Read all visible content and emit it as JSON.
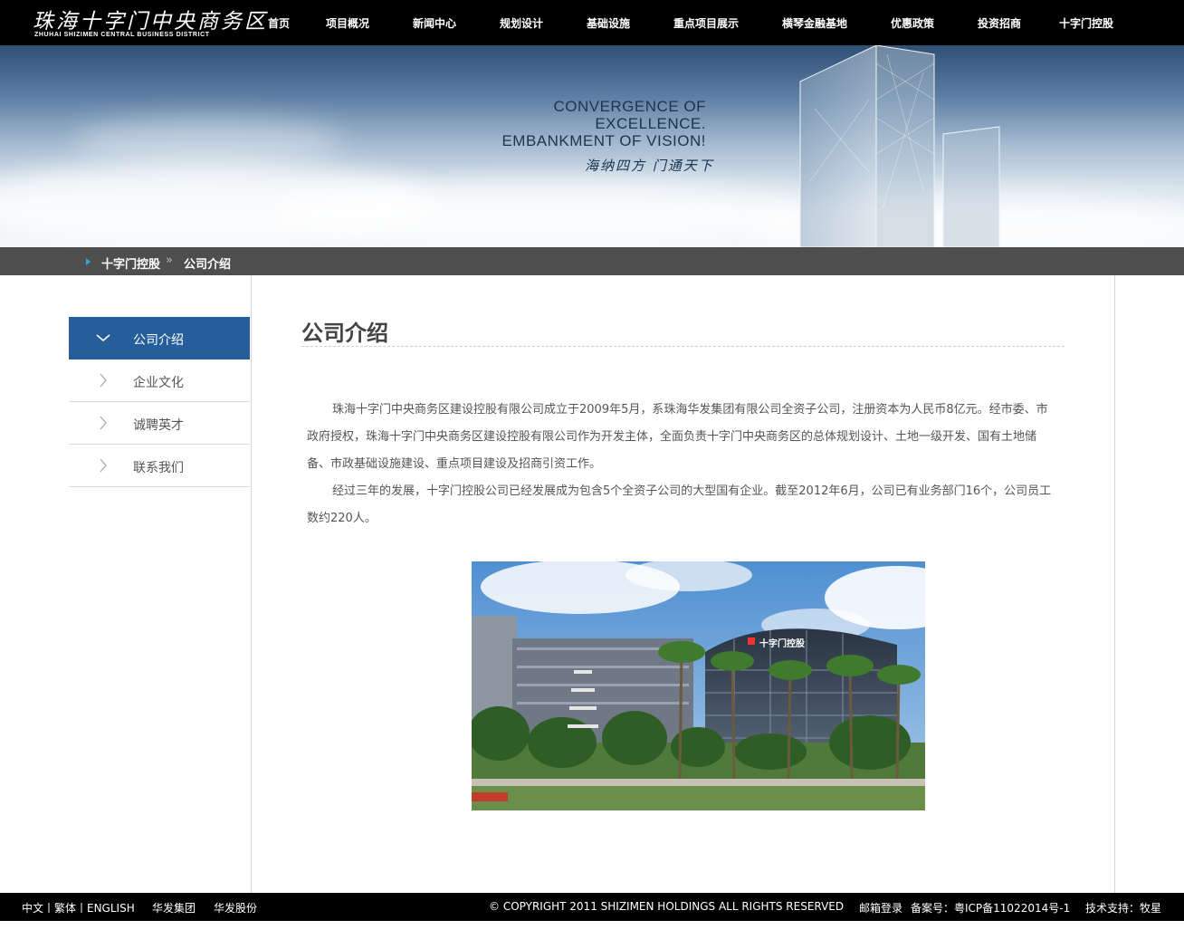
{
  "header": {
    "logo_cn": "珠海十字门中央商务区",
    "logo_en": "ZHUHAI SHIZIMEN CENTRAL BUSINESS DISTRICT",
    "nav": [
      "首页",
      "项目概况",
      "新闻中心",
      "规划设计",
      "基础设施",
      "重点项目展示",
      "横琴金融基地",
      "优惠政策",
      "投资招商",
      "十字门控股"
    ]
  },
  "banner": {
    "line1": "CONVERGENCE OF",
    "line2": "EXCELLENCE.",
    "line3": "EMBANKMENT OF VISION!",
    "slogan": "海纳四方 门通天下"
  },
  "breadcrumb": {
    "parent": "十字门控股",
    "separator": "»",
    "current": "公司介绍"
  },
  "sidebar": {
    "items": [
      {
        "label": "公司介绍",
        "active": true
      },
      {
        "label": "企业文化",
        "active": false
      },
      {
        "label": "诚聘英才",
        "active": false
      },
      {
        "label": "联系我们",
        "active": false
      }
    ]
  },
  "main": {
    "title": "公司介绍",
    "paragraphs": [
      "珠海十字门中央商务区建设控股有限公司成立于2009年5月，系珠海华发集团有限公司全资子公司，注册资本为人民币8亿元。经市委、市政府授权，珠海十字门中央商务区建设控股有限公司作为开发主体，全面负责十字门中央商务区的总体规划设计、土地一级开发、国有土地储备、市政基础设施建设、重点项目建设及招商引资工作。",
      "经过三年的发展，十字门控股公司已经发展成为包含5个全资子公司的大型国有企业。截至2012年6月，公司已有业务部门16个，公司员工数约220人。"
    ],
    "photo_sign": "十字门控股"
  },
  "footer": {
    "lang": "中文丨繁体丨ENGLISH",
    "link1": "华发集团",
    "link2": "华发股份",
    "copyright": "© COPYRIGHT 2011 SHIZIMEN HOLDINGS ALL RIGHTS RESERVED",
    "mail": "邮箱登录",
    "icp": "备案号：粤ICP备11022014号-1",
    "support": "技术支持：牧星"
  },
  "colors": {
    "topbar": "#000000",
    "crumbbar": "#4e4e4e",
    "accent": "#255e9b",
    "crumb_arrow": "#2ea4e0"
  }
}
